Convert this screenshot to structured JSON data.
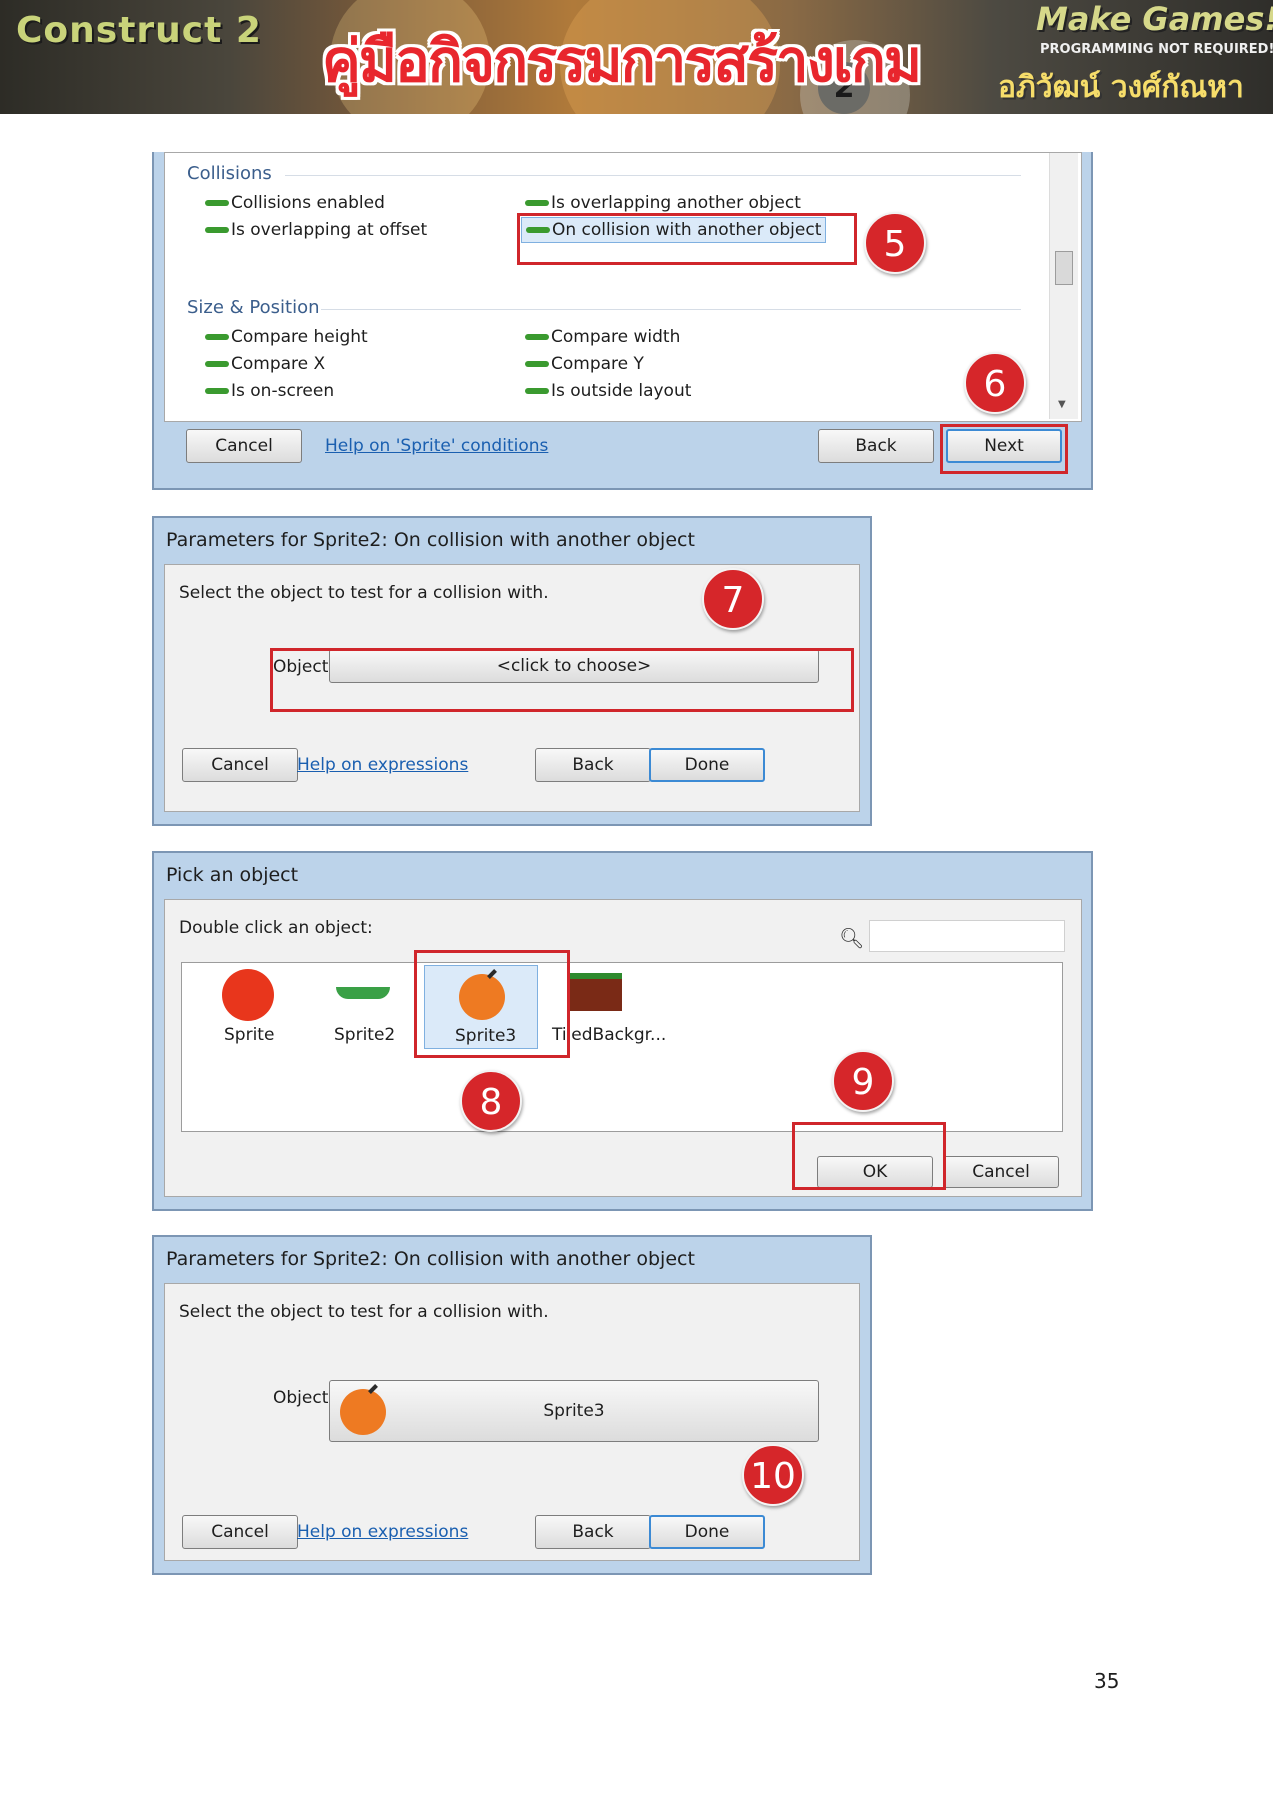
{
  "banner": {
    "left_title": "Construct 2",
    "thai_title": "คู่มือกิจกรรมการสร้างเกม",
    "thai_num": "2",
    "make_games": "Make Games!",
    "programming": "PROGRAMMING NOT REQUIRED!",
    "author": "อภิวัฒน์ วงศ์กัณหา"
  },
  "window1": {
    "section_collisions": "Collisions",
    "col_left": [
      "Collisions enabled",
      "Is overlapping at offset"
    ],
    "col_right": [
      "Is overlapping another object",
      "On collision with another object"
    ],
    "section_size": "Size & Position",
    "size_left": [
      "Compare height",
      "Compare X",
      "Is on-screen"
    ],
    "size_right": [
      "Compare width",
      "Compare Y",
      "Is outside layout"
    ],
    "cancel": "Cancel",
    "help": "Help on 'Sprite' conditions",
    "back": "Back",
    "next": "Next"
  },
  "window2": {
    "title": "Parameters for Sprite2: On collision with another object",
    "instruction": "Select the object to test for a collision with.",
    "object_label": "Object",
    "object_value": "<click to choose>",
    "cancel": "Cancel",
    "help": "Help on expressions",
    "back": "Back",
    "done": "Done"
  },
  "window3": {
    "title": "Pick an object",
    "instruction": "Double click an object:",
    "objects": [
      "Sprite",
      "Sprite2",
      "Sprite3",
      "TiledBackgr..."
    ],
    "ok": "OK",
    "cancel": "Cancel"
  },
  "window4": {
    "title": "Parameters for Sprite2: On collision with another object",
    "instruction": "Select the object to test for a collision with.",
    "object_label": "Object",
    "object_value": "Sprite3",
    "cancel": "Cancel",
    "help": "Help on expressions",
    "back": "Back",
    "done": "Done"
  },
  "steps": [
    "5",
    "6",
    "7",
    "8",
    "9",
    "10"
  ],
  "page_number": "35",
  "colors": {
    "annotation_red": "#d0262b",
    "link_blue": "#1a5fb0",
    "sprite_orange": "#ee7a22"
  }
}
